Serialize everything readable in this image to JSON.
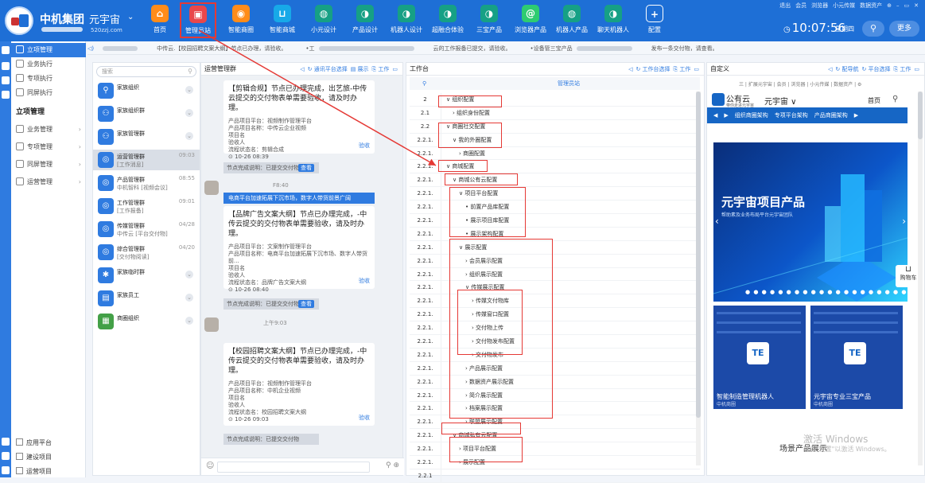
{
  "topbar": {
    "brand": "中机集团",
    "workspace": "元宇宙",
    "workspace_url": "520zzj.com",
    "nav": [
      {
        "label": "首页",
        "icon": "home-icon",
        "color": "#ff8c1a",
        "glyph": "⌂"
      },
      {
        "label": "管理员站",
        "icon": "admin-site-icon",
        "color": "#e8474b",
        "glyph": "▣"
      },
      {
        "label": "智能商圈",
        "icon": "smart-circle-icon",
        "color": "#ff8c1a",
        "glyph": "◉"
      },
      {
        "label": "智能商城",
        "icon": "cart-icon",
        "color": "#17a9e8",
        "glyph": "⊔"
      },
      {
        "label": "小元设计",
        "icon": "globe-icon",
        "color": "#16a085",
        "glyph": "◍"
      },
      {
        "label": "产品设计",
        "icon": "bot-face-icon",
        "color": "#16a085",
        "glyph": "◑"
      },
      {
        "label": "机器人设计",
        "icon": "bot-face-icon",
        "color": "#16a085",
        "glyph": "◑"
      },
      {
        "label": "超融合体验",
        "icon": "bot-face-icon",
        "color": "#16a085",
        "glyph": "◑"
      },
      {
        "label": "三宝产品",
        "icon": "bot-face-icon",
        "color": "#16a085",
        "glyph": "◑"
      },
      {
        "label": "浏览器产品",
        "icon": "browser-icon",
        "color": "#2ecc71",
        "glyph": "@"
      },
      {
        "label": "机器人产品",
        "icon": "globe-icon",
        "color": "#16a085",
        "glyph": "◍"
      },
      {
        "label": "聊天机器人",
        "icon": "bot-face-icon",
        "color": "#16a085",
        "glyph": "◑"
      },
      {
        "label": "配置",
        "icon": "plus-icon",
        "color": "#1e6fd6",
        "glyph": "+"
      }
    ],
    "top_links": [
      "退出",
      "会员",
      "浏览器",
      "小元传媒",
      "数据资产",
      "⊕",
      "–",
      "▭",
      "✕"
    ],
    "time": "10:07:56",
    "weekday": "星期四",
    "more": "更多"
  },
  "sidebar": {
    "top_items": [
      {
        "label": "立项管理",
        "active": true
      },
      {
        "label": "业务执行",
        "active": false
      },
      {
        "label": "专项执行",
        "active": false
      },
      {
        "label": "同屏执行",
        "active": false
      }
    ],
    "group": "立项管理",
    "sub_items": [
      "业务管理",
      "专项管理",
      "同屏管理",
      "运营管理"
    ],
    "bottom_items": [
      "应用平台",
      "建设项目",
      "运营项目"
    ]
  },
  "notice": {
    "items": [
      "中传云.【校园招聘文案大纲】节点已办理，请验收。",
      "•工",
      "云的工作报备已提交，请验收。",
      "•设备管三宝产品",
      "发布一条交付物，请查看。"
    ]
  },
  "contacts": {
    "search_placeholder": "搜索",
    "items": [
      {
        "name": "家族组织",
        "sub": "",
        "time": "",
        "color": "#2f7be0",
        "glyph": "⚲"
      },
      {
        "name": "家族组织群",
        "sub": "",
        "time": "",
        "color": "#2f7be0",
        "glyph": "⚇"
      },
      {
        "name": "家族管理群",
        "sub": "",
        "time": "",
        "color": "#2f7be0",
        "glyph": "⚇"
      },
      {
        "name": "运营管理群",
        "sub": "[工作消息]",
        "time": "09:03",
        "color": "#2f7be0",
        "glyph": "◎",
        "selected": true
      },
      {
        "name": "产品管理群",
        "sub": "中机智科 [视频会议]",
        "time": "08:55",
        "color": "#2f7be0",
        "glyph": "◎"
      },
      {
        "name": "工作管理群",
        "sub": "[工作报备]",
        "time": "09:01",
        "color": "#2f7be0",
        "glyph": "◎"
      },
      {
        "name": "传媒管理群",
        "sub": "中传云 [平台交付物]",
        "time": "04/28",
        "color": "#2f7be0",
        "glyph": "◎"
      },
      {
        "name": "综合管理群",
        "sub": "[交付物阅读]",
        "time": "04/20",
        "color": "#2f7be0",
        "glyph": "◎"
      },
      {
        "name": "家族临时群",
        "sub": "",
        "time": "",
        "color": "#2f7be0",
        "glyph": "✱"
      },
      {
        "name": "家族员工",
        "sub": "",
        "time": "",
        "color": "#2f7be0",
        "glyph": "▤"
      },
      {
        "name": "商圈组织",
        "sub": "",
        "time": "",
        "color": "#43a047",
        "glyph": "▦"
      }
    ]
  },
  "chat": {
    "title": "运营管理群",
    "tools": [
      "◁",
      "↻ 通讯平台选择",
      "▤ 展示",
      "⎘ 工作",
      "▭"
    ],
    "card1": {
      "title": "【剪辑合规】节点已办理完成，出艺旅-中传云提交的交付物表单需要验收，请及时办理。",
      "lines": [
        "产品项目平台：视频制作管理平台",
        "产品项目名称：中传云企业视频",
        "项目名",
        "验收人",
        "流程状态名：剪辑合成",
        "⊙ 10-26 08:39"
      ],
      "done": "验收"
    },
    "ack1": {
      "text": "节点完成说明：已提交交付物",
      "btn": "查看"
    },
    "msg2_time": "F8:40",
    "card2": {
      "header": "电商平台加速拓展下沉市场，数字人带货前景广阔",
      "title": "【品牌广告文案大纲】节点已办理完成，-中传云提交的交付物表单需要验收，请及时办理。",
      "lines": [
        "产品项目平台：文案制作管理平台",
        "产品项目名称：电商平台加速拓展下沉市场、数字人带货前...",
        "项目名",
        "验收人",
        "流程状态名：品牌广告文案大纲",
        "⊙ 10-26 08:40"
      ],
      "done": "验收"
    },
    "ack2": {
      "text": "节点完成说明：已提交交付物",
      "btn": "查看"
    },
    "msg3_time": "上午9:03",
    "card3": {
      "title": "【校园招聘文案大纲】节点已办理完成，-中传云提交的交付物表单需要验收，请及时办理。",
      "lines": [
        "产品项目平台：视频制作管理平台",
        "产品项目名称：中机企业视频",
        "项目名",
        "验收人",
        "流程状态名：校园招聘文案大纲",
        "⊙ 10-26 09:03"
      ],
      "done": "验收"
    },
    "ack3": {
      "text": "节点完成说明：已提交交付物",
      "btn": "查看"
    }
  },
  "workbench": {
    "title": "工作台",
    "tools": [
      "◁",
      "↻ 工作台选择",
      "⎘ 工作",
      "▭"
    ],
    "column": "管理员站",
    "rows": [
      {
        "num": "2",
        "label": "∨ 组织配置",
        "indent": 0
      },
      {
        "num": "2.1",
        "label": "› 组织身份配置",
        "indent": 1
      },
      {
        "num": "2.2",
        "label": "∨ 商圈社交配置",
        "indent": 0
      },
      {
        "num": "2.2.1.",
        "label": "∨ 我的外圈配置",
        "indent": 1
      },
      {
        "num": "2.2.1.",
        "label": "› 商圈配置",
        "indent": 2
      },
      {
        "num": "2.2.1.",
        "label": "∨ 商城配置",
        "indent": 0
      },
      {
        "num": "2.2.1.",
        "label": "∨ 商城公有云配置",
        "indent": 1
      },
      {
        "num": "2.2.1.",
        "label": "∨ 项目平台配置",
        "indent": 2
      },
      {
        "num": "2.2.1.",
        "label": "• 前置产品库配置",
        "indent": 3
      },
      {
        "num": "2.2.1.",
        "label": "• 展示项目库配置",
        "indent": 3
      },
      {
        "num": "2.2.1.",
        "label": "• 展示架构配置",
        "indent": 3
      },
      {
        "num": "2.2.1.",
        "label": "∨ 展示配置",
        "indent": 2
      },
      {
        "num": "2.2.1.",
        "label": "› 会员展示配置",
        "indent": 3
      },
      {
        "num": "2.2.1.",
        "label": "› 组织展示配置",
        "indent": 3
      },
      {
        "num": "2.2.1.",
        "label": "∨ 传媒展示配置",
        "indent": 3
      },
      {
        "num": "2.2.1.",
        "label": "› 传媒文付物库",
        "indent": 4
      },
      {
        "num": "2.2.1.",
        "label": "› 传媒窗口配置",
        "indent": 4
      },
      {
        "num": "2.2.1.",
        "label": "› 交付物上传",
        "indent": 4
      },
      {
        "num": "2.2.1.",
        "label": "› 交付物发布配置",
        "indent": 4
      },
      {
        "num": "2.2.1.",
        "label": "› 交付物发布",
        "indent": 4
      },
      {
        "num": "2.2.1.",
        "label": "› 产品展示配置",
        "indent": 3
      },
      {
        "num": "2.2.1.",
        "label": "› 数据资产展示配置",
        "indent": 3
      },
      {
        "num": "2.2.1.",
        "label": "› 简介展示配置",
        "indent": 3
      },
      {
        "num": "2.2.1.",
        "label": "› 档案展示配置",
        "indent": 3
      },
      {
        "num": "2.2.1.",
        "label": "› 联盟展示配置",
        "indent": 3
      },
      {
        "num": "2.2.1.",
        "label": "∨ 商城私有云配置",
        "indent": 1
      },
      {
        "num": "2.2.1.",
        "label": "› 项目平台配置",
        "indent": 2
      },
      {
        "num": "2.2.1.",
        "label": "› 展示配置",
        "indent": 2
      },
      {
        "num": "2.2.1",
        "label": "",
        "indent": 0
      }
    ]
  },
  "custom": {
    "title": "自定义",
    "tools": [
      "◁",
      "↻ 配导航",
      "↻ 平台选择",
      "⎘ 工作",
      "▭"
    ],
    "site_links": "三 | 扩展元宇宙 | 会员 | 浏览器 | 小元传媒 | 数据资产 | ⚙",
    "site_brand": "公有云",
    "site_brand_sub": "带你走进元宇宙",
    "site_ws": "元宇宙 ∨",
    "site_home": "首页",
    "site_nav": [
      "◀",
      "▶",
      "组织商圈架构",
      "专项平台架构",
      "产品商圈架构",
      "▶"
    ],
    "banner_title": "元宇宙项目产品",
    "banner_sub": "帮助素及业务布局平台元宇宙团队",
    "banner_dots": "● ● ● ● ● ● ● ● ● ● ● ● ● ● ● ● ● ● ● ●",
    "cart": "购物车",
    "products": [
      {
        "title": "智能制造管理机器人",
        "sub": "中机商圈"
      },
      {
        "title": "元宇宙专业三宝产品",
        "sub": "中机商圈"
      }
    ],
    "scene": "场景产品展示"
  },
  "watermark": {
    "line1": "激活 Windows",
    "line2": "转到\"设置\"以激活 Windows。"
  }
}
